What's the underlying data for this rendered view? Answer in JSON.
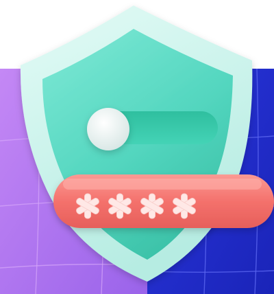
{
  "illustration": {
    "subject": "security-shield-icon",
    "colors": {
      "background_left": "#b77cf0",
      "background_right": "#1f2fd6",
      "shield_outer": "#c9f3ec",
      "shield_inner": "#5fdcc6",
      "toggle_track": "#34c9ab",
      "toggle_knob": "#eef6f5",
      "password_bar": "#f47c78",
      "asterisk": "#ffe4e2"
    },
    "toggle": {
      "state": "off"
    },
    "password_mask": {
      "characters": "****"
    }
  }
}
